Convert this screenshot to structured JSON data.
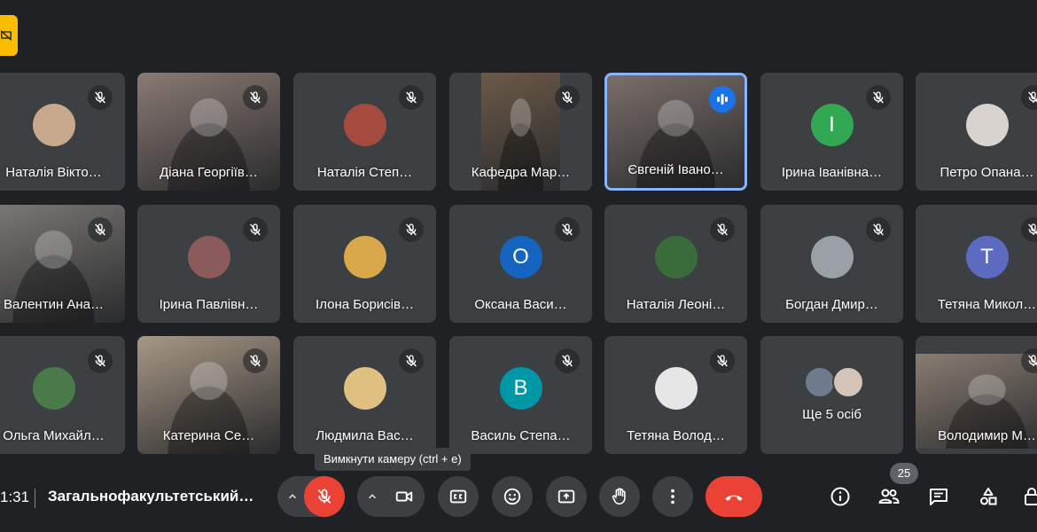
{
  "tiles": [
    {
      "name": "Наталія Вікто…",
      "avatar_color": "#c9a98c"
    },
    {
      "name": "Діана Георгіїв…",
      "video_color": "#8a7a74"
    },
    {
      "name": "Наталія Степ…",
      "avatar_color": "#a44a3f"
    },
    {
      "name": "Кафедра Мар…",
      "video_color": "#6b5a48"
    },
    {
      "name": "Євгеній Івано…",
      "video_color": "#7a6e6a"
    },
    {
      "name": "Ірина Іванівна…",
      "initial": "І",
      "avatar_color": "#33a852"
    },
    {
      "name": "Петро Опана…",
      "avatar_color": "#d8d3ce"
    },
    {
      "name": "Валентин Ана…",
      "video_color": "#7d7a76"
    },
    {
      "name": "Ірина Павлівн…",
      "avatar_color": "#8b5a5a"
    },
    {
      "name": "Ілона Борисів…",
      "avatar_color": "#d9a84a"
    },
    {
      "name": "Оксана Васи…",
      "initial": "О",
      "avatar_color": "#1565c0"
    },
    {
      "name": "Наталія Леоні…",
      "avatar_color": "#3a6b3a"
    },
    {
      "name": "Богдан Дмир…",
      "avatar_color": "#9aa0a6"
    },
    {
      "name": "Тетяна Микол…",
      "initial": "Т",
      "avatar_color": "#5c6bc0"
    },
    {
      "name": "Ольга Михайл…",
      "avatar_color": "#4a7a4a"
    },
    {
      "name": "Катерина Се…",
      "video_color": "#a89886"
    },
    {
      "name": "Людмила Вас…",
      "avatar_color": "#e0c080"
    },
    {
      "name": "Василь Степа…",
      "initial": "В",
      "avatar_color": "#0097a7"
    },
    {
      "name": "Тетяна Волод…",
      "avatar_color": "#e6e6e6"
    },
    {
      "name": "Ще 5 осіб"
    },
    {
      "name": "Володимир М…",
      "video_color": "#8a7d72"
    }
  ],
  "tooltip": "Вимкнути камеру (ctrl + e)",
  "bottom": {
    "time": "1:31",
    "meeting_title": "Загальнофакультетський…",
    "participant_count": "25"
  },
  "colors": {
    "background": "#202124",
    "tile": "#3c4043",
    "danger": "#ea4335",
    "speaking": "#8ab4f8",
    "present_badge": "#fbbc04"
  }
}
